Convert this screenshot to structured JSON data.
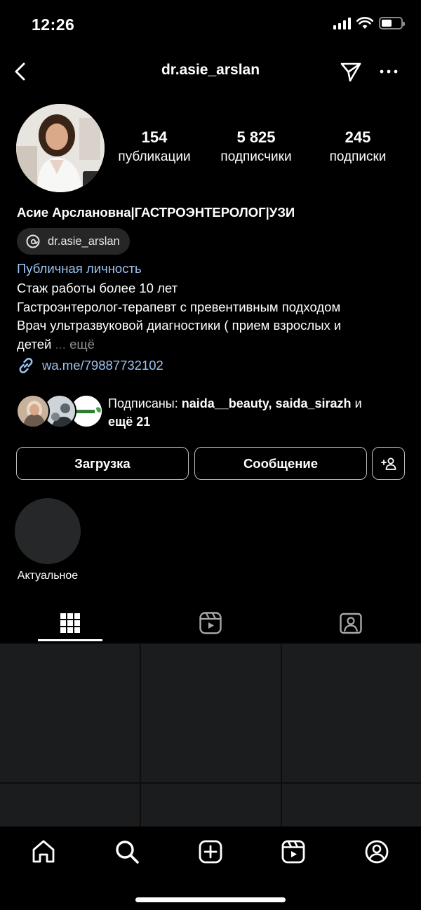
{
  "status_bar": {
    "time": "12:26",
    "icons": [
      "signal-icon",
      "wifi-icon",
      "battery-icon"
    ]
  },
  "nav": {
    "title": "dr.asie_arslan",
    "icons": [
      "back-chevron-icon",
      "send-icon",
      "more-icon"
    ]
  },
  "profile": {
    "stats": [
      {
        "value": "154",
        "label": "публикации"
      },
      {
        "value": "5 825",
        "label": "подписчики"
      },
      {
        "value": "245",
        "label": "подписки"
      }
    ],
    "name": "Асие Арслановна|ГАСТРОЭНТЕРОЛОГ|УЗИ",
    "threads_handle": "dr.asie_arslan",
    "category": "Публичная личность",
    "bio_lines": [
      "Стаж работы более 10 лет",
      "Гастроэнтеролог-терапевт с превентивным подходом",
      "Врач ультразвуковой диагностики ( прием взрослых и"
    ],
    "bio_last": "детей",
    "bio_more": "ещё",
    "link": "wa.me/79887732102"
  },
  "followers": {
    "prefix": "Подписаны:",
    "names": "naida__beauty, saida_sirazh",
    "conj": "и",
    "more": "ещё 21"
  },
  "buttons": {
    "upload": "Загрузка",
    "message": "Сообщение"
  },
  "highlights": [
    {
      "label": "Актуальное"
    }
  ],
  "tabs": [
    "grid-icon",
    "reels-icon",
    "tagged-icon"
  ],
  "bottom_nav": [
    "home-icon",
    "search-icon",
    "create-icon",
    "reels-icon",
    "profile-icon"
  ],
  "colors": {
    "background": "#000000",
    "link": "#9cc3f0",
    "chip": "#262626",
    "grid_cell": "#1b1c1e"
  }
}
